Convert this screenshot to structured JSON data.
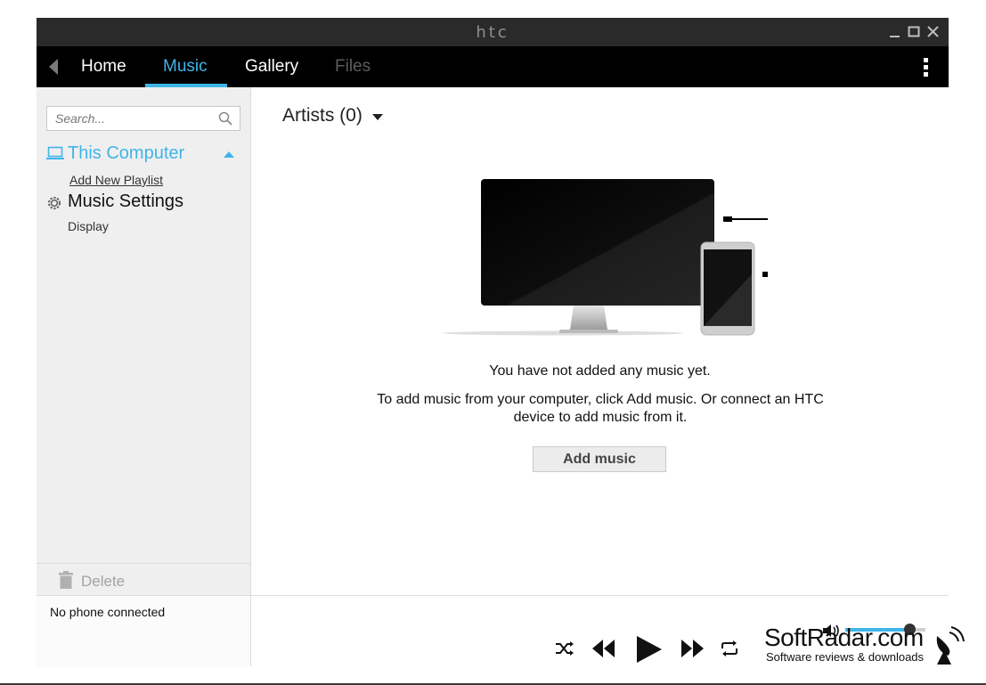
{
  "window": {
    "brand": "htc",
    "controls": [
      "minimize",
      "maximize",
      "close"
    ]
  },
  "nav": {
    "tabs": [
      {
        "label": "Home",
        "state": "normal"
      },
      {
        "label": "Music",
        "state": "active"
      },
      {
        "label": "Gallery",
        "state": "normal"
      },
      {
        "label": "Files",
        "state": "disabled"
      }
    ]
  },
  "sidebar": {
    "search_placeholder": "Search...",
    "source_label": "This Computer",
    "add_playlist": "Add New Playlist",
    "settings_label": "Music Settings",
    "display_link": "Display",
    "delete_label": "Delete",
    "status": "No phone connected"
  },
  "main": {
    "artists_label": "Artists (0)",
    "empty_title": "You have not added any music yet.",
    "empty_body": "To add music from your computer, click Add music. Or connect an HTC device to add music from it.",
    "add_music_label": "Add music"
  },
  "player": {
    "volume_fraction": 0.8
  },
  "watermark": {
    "title": "SoftRadar.com",
    "subtitle": "Software reviews & downloads"
  },
  "colors": {
    "accent": "#3eb5ea",
    "titlebar": "#2a2a2a",
    "navbar": "#000000",
    "sidebar": "#efefef"
  }
}
